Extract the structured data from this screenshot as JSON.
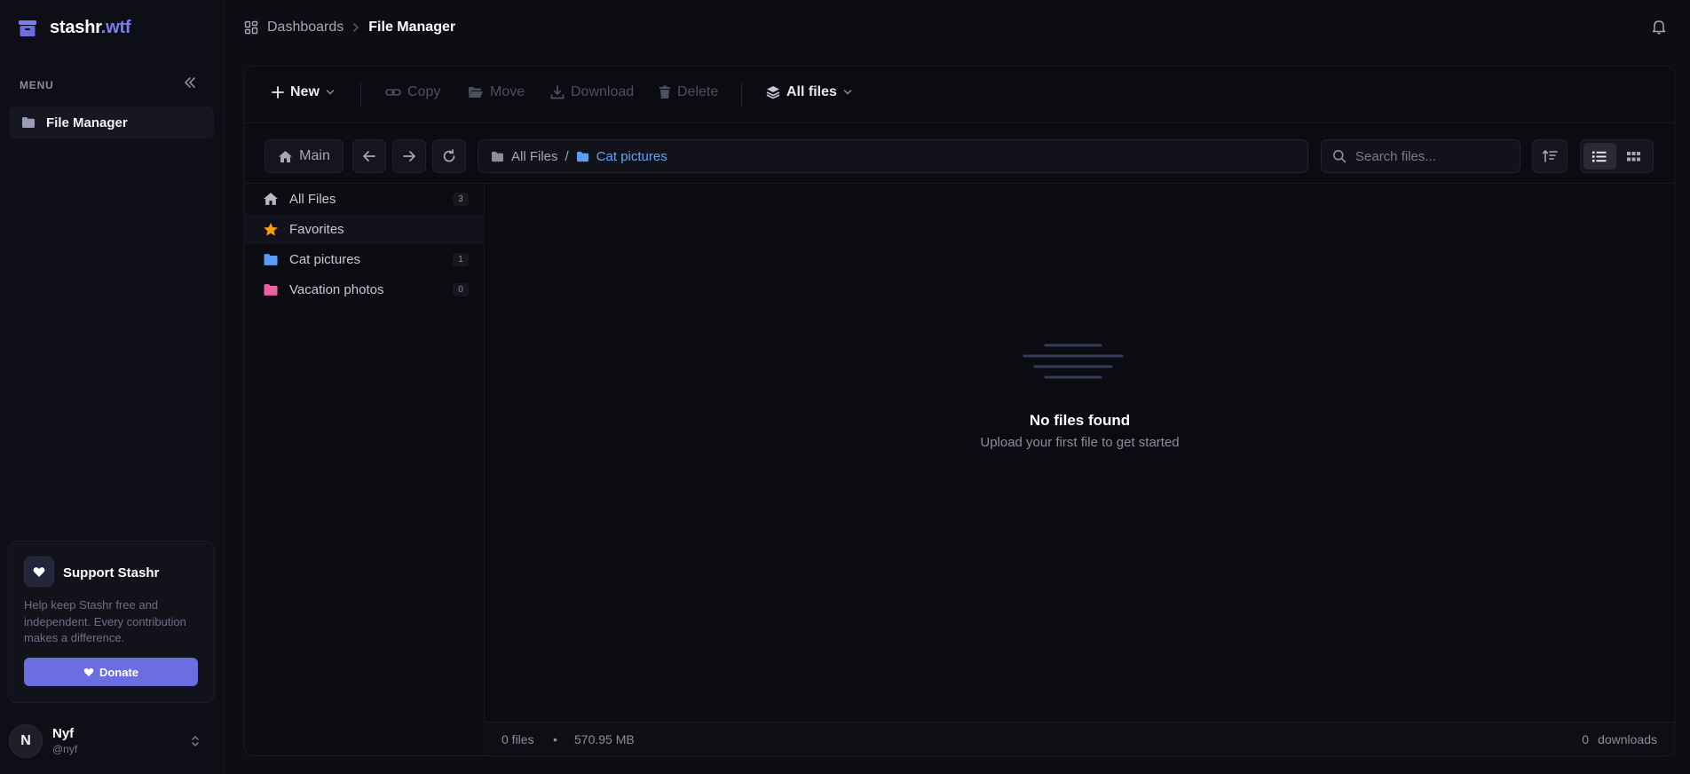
{
  "brand": {
    "name": "stashr",
    "suffix": ".wtf",
    "logo_icon": "archive-box-icon"
  },
  "sidebar": {
    "menu_label": "MENU",
    "items": [
      {
        "label": "File Manager",
        "icon": "folder-icon"
      }
    ],
    "support": {
      "title": "Support Stashr",
      "text": "Help keep Stashr free and independent. Every contribution makes a difference.",
      "donate_label": "Donate"
    },
    "user": {
      "initial": "N",
      "name": "Nyf",
      "handle": "@nyf"
    }
  },
  "header": {
    "breadcrumb": [
      {
        "label": "Dashboards"
      },
      {
        "label": "File Manager"
      }
    ]
  },
  "toolbar": {
    "new_label": "New",
    "copy_label": "Copy",
    "move_label": "Move",
    "download_label": "Download",
    "delete_label": "Delete",
    "filter_label": "All files"
  },
  "navbar": {
    "main_label": "Main",
    "path": [
      {
        "label": "All Files"
      },
      {
        "label": "Cat pictures"
      }
    ],
    "path_separator": "/",
    "search_placeholder": "Search files..."
  },
  "tree": {
    "items": [
      {
        "label": "All Files",
        "count": "3",
        "icon": "home-icon",
        "color": "#b8b8c8"
      },
      {
        "label": "Favorites",
        "count": "",
        "icon": "star-icon",
        "color": "#f59e0b"
      },
      {
        "label": "Cat pictures",
        "count": "1",
        "icon": "folder-icon",
        "color": "#5b9cf4"
      },
      {
        "label": "Vacation photos",
        "count": "0",
        "icon": "folder-icon",
        "color": "#ec5fa4"
      }
    ]
  },
  "empty": {
    "title": "No files found",
    "subtitle": "Upload your first file to get started"
  },
  "status": {
    "files": "0 files",
    "dot": "•",
    "size": "570.95 MB",
    "downloads_count": "0",
    "downloads_label": "downloads"
  },
  "colors": {
    "accent": "#6b6ee0",
    "brand_accent": "#7c7ef0",
    "path_active": "#62a4f7",
    "background": "#0d0d14"
  }
}
